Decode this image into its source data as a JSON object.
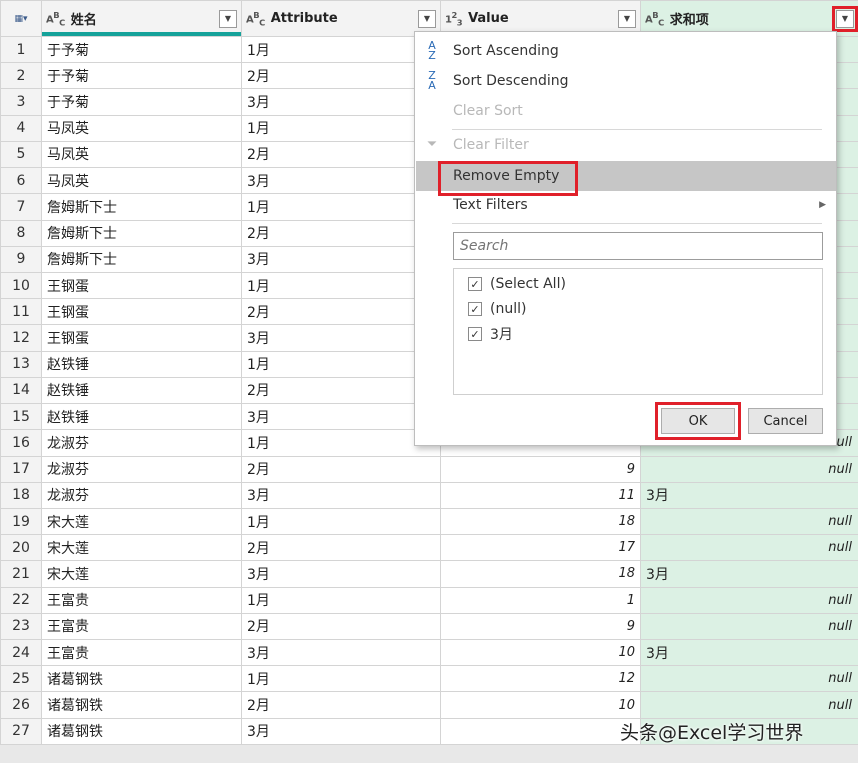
{
  "columns": [
    {
      "name": "姓名",
      "type": "ABC"
    },
    {
      "name": "Attribute",
      "type": "ABC"
    },
    {
      "name": "Value",
      "type": "123"
    },
    {
      "name": "求和项",
      "type": "ABC"
    }
  ],
  "rows": [
    {
      "n": "1",
      "name": "于予菊",
      "attr": "1月",
      "value": "",
      "sum": ""
    },
    {
      "n": "2",
      "name": "于予菊",
      "attr": "2月",
      "value": "",
      "sum": ""
    },
    {
      "n": "3",
      "name": "于予菊",
      "attr": "3月",
      "value": "",
      "sum": ""
    },
    {
      "n": "4",
      "name": "马凤英",
      "attr": "1月",
      "value": "",
      "sum": ""
    },
    {
      "n": "5",
      "name": "马凤英",
      "attr": "2月",
      "value": "",
      "sum": ""
    },
    {
      "n": "6",
      "name": "马凤英",
      "attr": "3月",
      "value": "",
      "sum": ""
    },
    {
      "n": "7",
      "name": "詹姆斯下士",
      "attr": "1月",
      "value": "",
      "sum": ""
    },
    {
      "n": "8",
      "name": "詹姆斯下士",
      "attr": "2月",
      "value": "",
      "sum": ""
    },
    {
      "n": "9",
      "name": "詹姆斯下士",
      "attr": "3月",
      "value": "",
      "sum": ""
    },
    {
      "n": "10",
      "name": "王钢蛋",
      "attr": "1月",
      "value": "",
      "sum": ""
    },
    {
      "n": "11",
      "name": "王钢蛋",
      "attr": "2月",
      "value": "",
      "sum": ""
    },
    {
      "n": "12",
      "name": "王钢蛋",
      "attr": "3月",
      "value": "",
      "sum": ""
    },
    {
      "n": "13",
      "name": "赵铁锤",
      "attr": "1月",
      "value": "",
      "sum": ""
    },
    {
      "n": "14",
      "name": "赵铁锤",
      "attr": "2月",
      "value": "",
      "sum": ""
    },
    {
      "n": "15",
      "name": "赵铁锤",
      "attr": "3月",
      "value": "",
      "sum": ""
    },
    {
      "n": "16",
      "name": "龙淑芬",
      "attr": "1月",
      "value": "",
      "sum": "null"
    },
    {
      "n": "17",
      "name": "龙淑芬",
      "attr": "2月",
      "value": "9",
      "sum": "null"
    },
    {
      "n": "18",
      "name": "龙淑芬",
      "attr": "3月",
      "value": "11",
      "sum": "3月"
    },
    {
      "n": "19",
      "name": "宋大莲",
      "attr": "1月",
      "value": "18",
      "sum": "null"
    },
    {
      "n": "20",
      "name": "宋大莲",
      "attr": "2月",
      "value": "17",
      "sum": "null"
    },
    {
      "n": "21",
      "name": "宋大莲",
      "attr": "3月",
      "value": "18",
      "sum": "3月"
    },
    {
      "n": "22",
      "name": "王富贵",
      "attr": "1月",
      "value": "1",
      "sum": "null"
    },
    {
      "n": "23",
      "name": "王富贵",
      "attr": "2月",
      "value": "9",
      "sum": "null"
    },
    {
      "n": "24",
      "name": "王富贵",
      "attr": "3月",
      "value": "10",
      "sum": "3月"
    },
    {
      "n": "25",
      "name": "诸葛钢铁",
      "attr": "1月",
      "value": "12",
      "sum": "null"
    },
    {
      "n": "26",
      "name": "诸葛钢铁",
      "attr": "2月",
      "value": "10",
      "sum": "null"
    },
    {
      "n": "27",
      "name": "诸葛钢铁",
      "attr": "3月",
      "value": "",
      "sum": ""
    }
  ],
  "menu": {
    "sort_asc": "Sort Ascending",
    "sort_desc": "Sort Descending",
    "clear_sort": "Clear Sort",
    "clear_filter": "Clear Filter",
    "remove_empty": "Remove Empty",
    "text_filters": "Text Filters",
    "search_placeholder": "Search",
    "filter_items": [
      {
        "label": "(Select All)",
        "checked": true
      },
      {
        "label": "(null)",
        "checked": true
      },
      {
        "label": "3月",
        "checked": true
      }
    ],
    "ok": "OK",
    "cancel": "Cancel"
  },
  "watermark": "头条@Excel学习世界",
  "colors": {
    "accent_red": "#e0202a",
    "quality_bar": "#15a29a",
    "sum_column_bg": "#dcf1e4"
  },
  "icons": {
    "table_menu": "table-icon",
    "filter": "dropdown-arrow-icon",
    "sort_asc": "sort-ascending-icon",
    "sort_desc": "sort-descending-icon",
    "clear_filter": "clear-filter-icon",
    "submenu": "chevron-right-icon"
  }
}
